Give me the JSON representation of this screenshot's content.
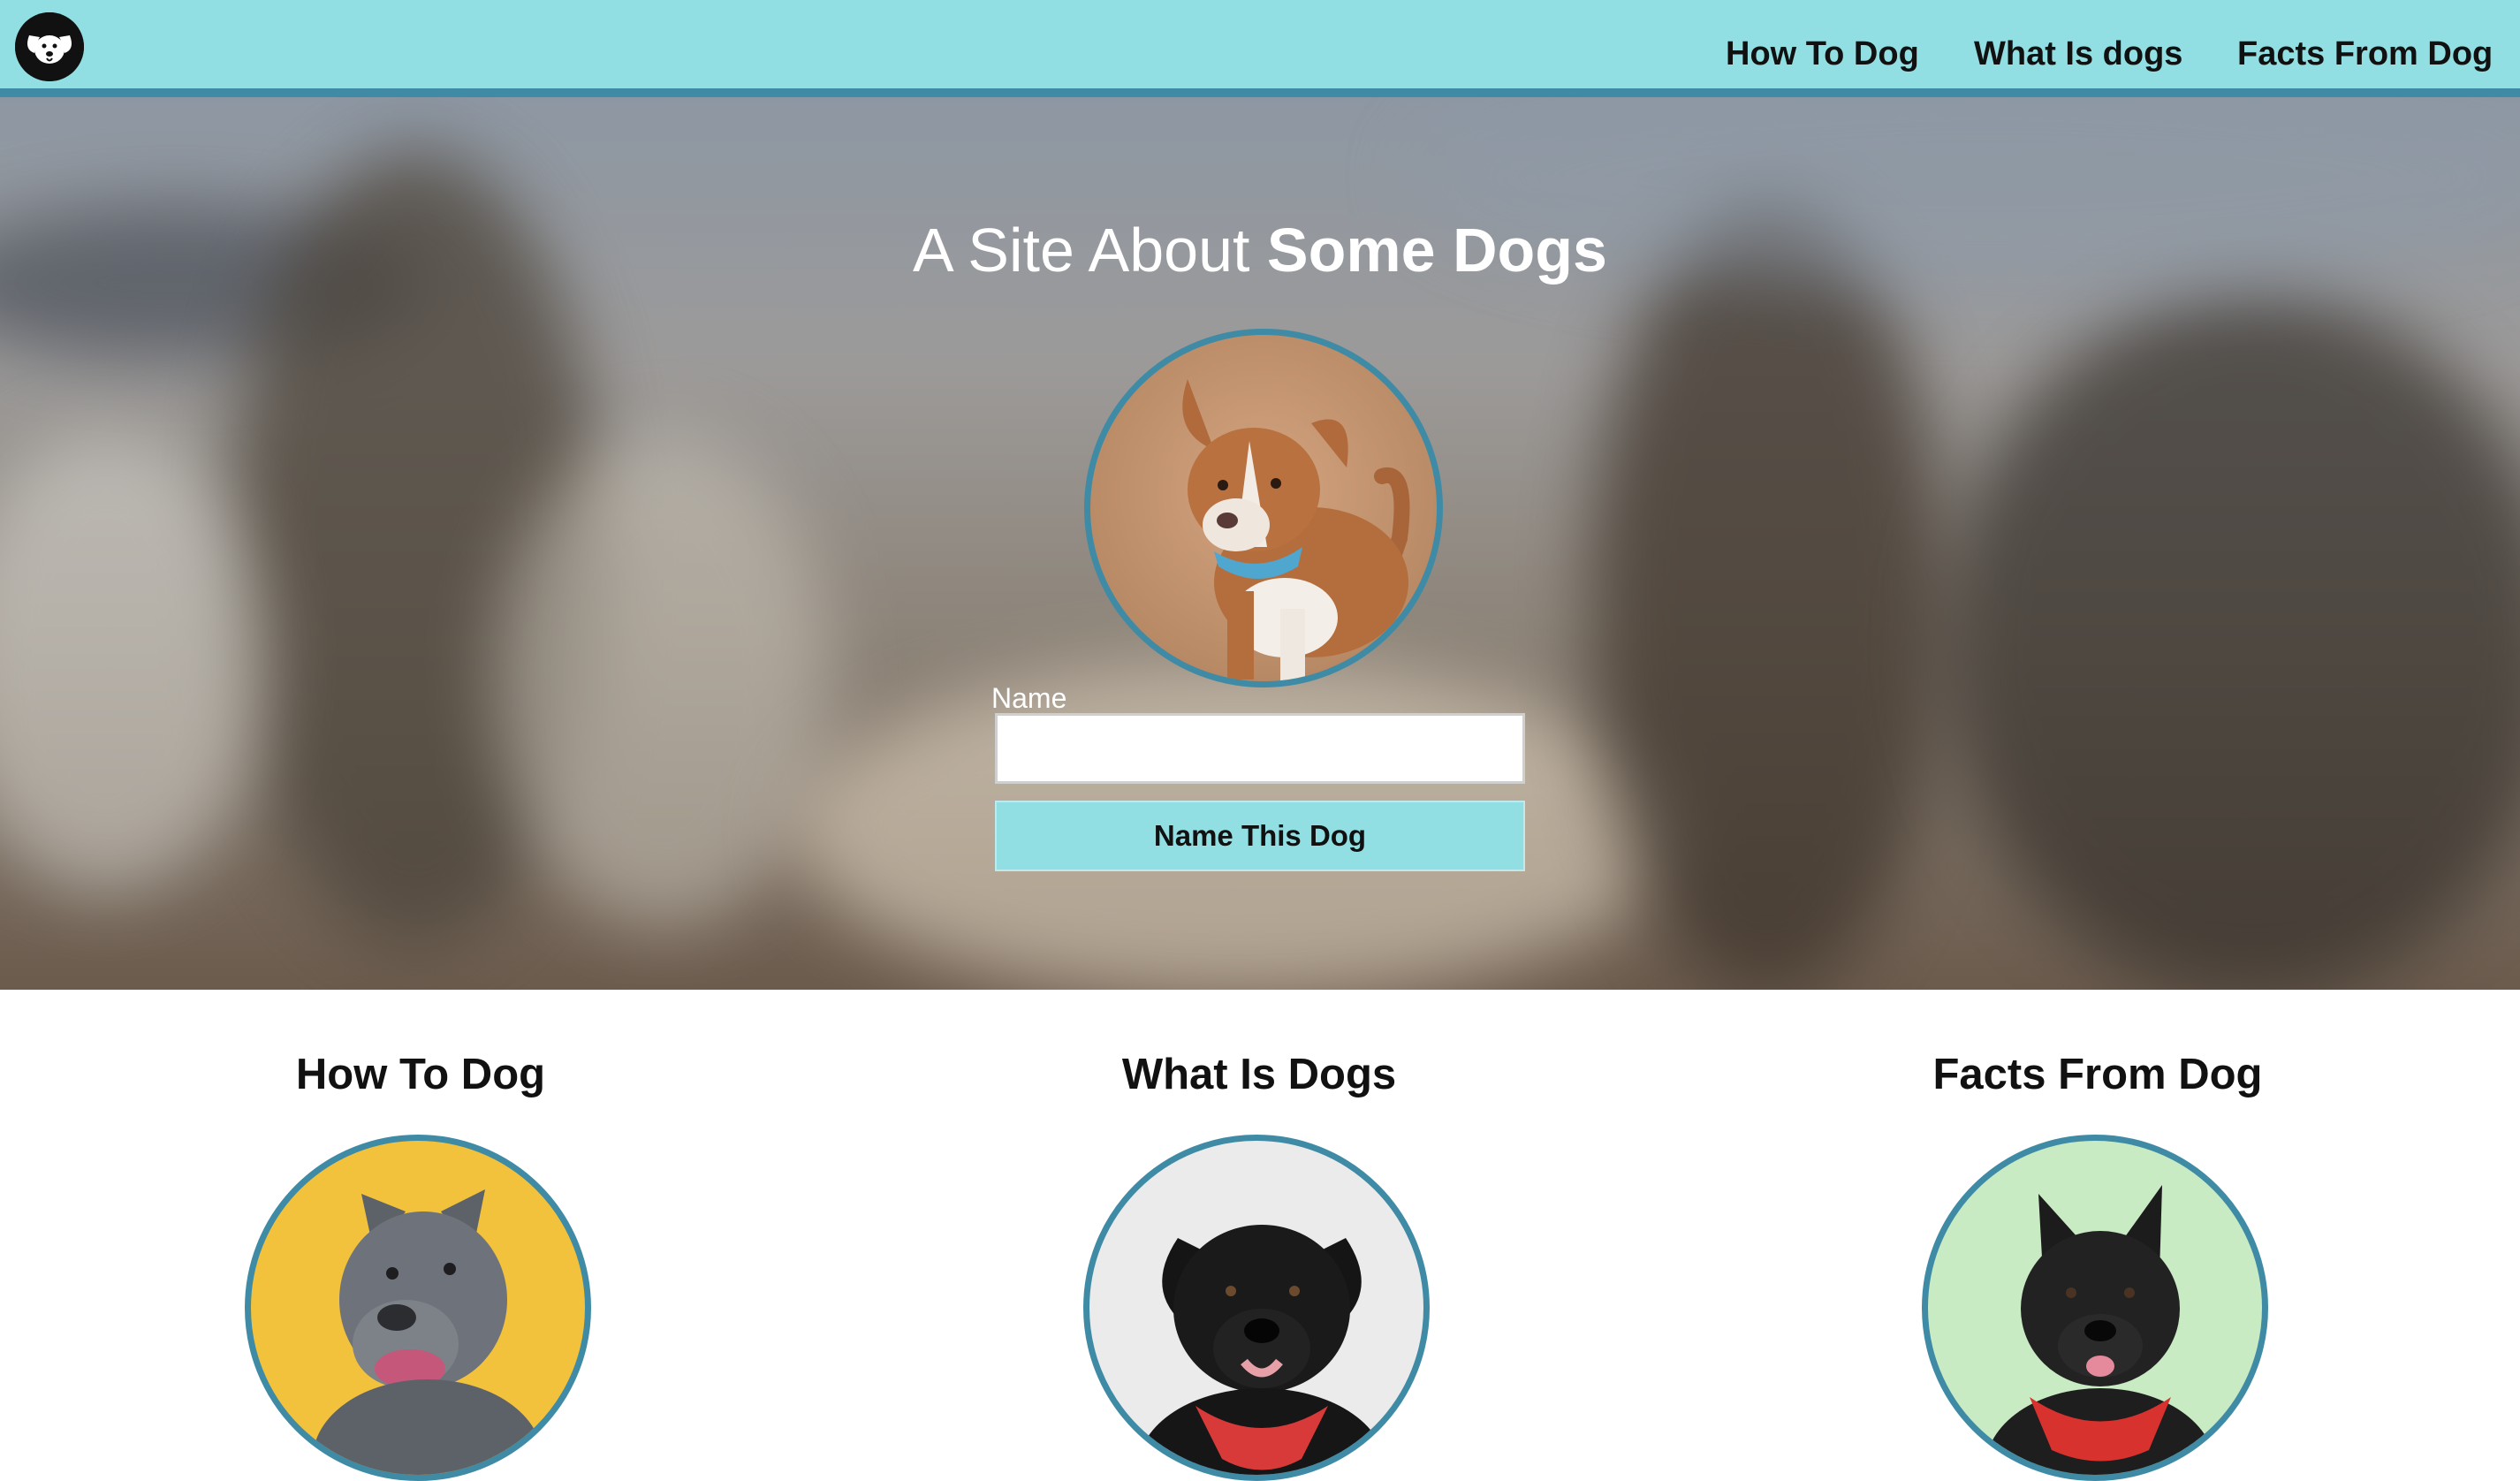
{
  "nav": {
    "logo_icon": "dog-face-icon",
    "links": [
      "How To Dog",
      "What Is dogs",
      "Facts From Dog"
    ]
  },
  "hero": {
    "title_light": "A Site About ",
    "title_bold": "Some Dogs",
    "name_label": "Name",
    "name_value": "",
    "button_label": "Name This Dog"
  },
  "cards": [
    {
      "title": "How To Dog",
      "image": "gray-dog-photo"
    },
    {
      "title": "What Is Dogs",
      "image": "black-dog-photo"
    },
    {
      "title": "Facts From Dog",
      "image": "black-frenchie-photo"
    }
  ],
  "colors": {
    "nav_bg": "#91dfe3",
    "accent": "#3f8ba6",
    "button_bg": "#91dfe3"
  }
}
